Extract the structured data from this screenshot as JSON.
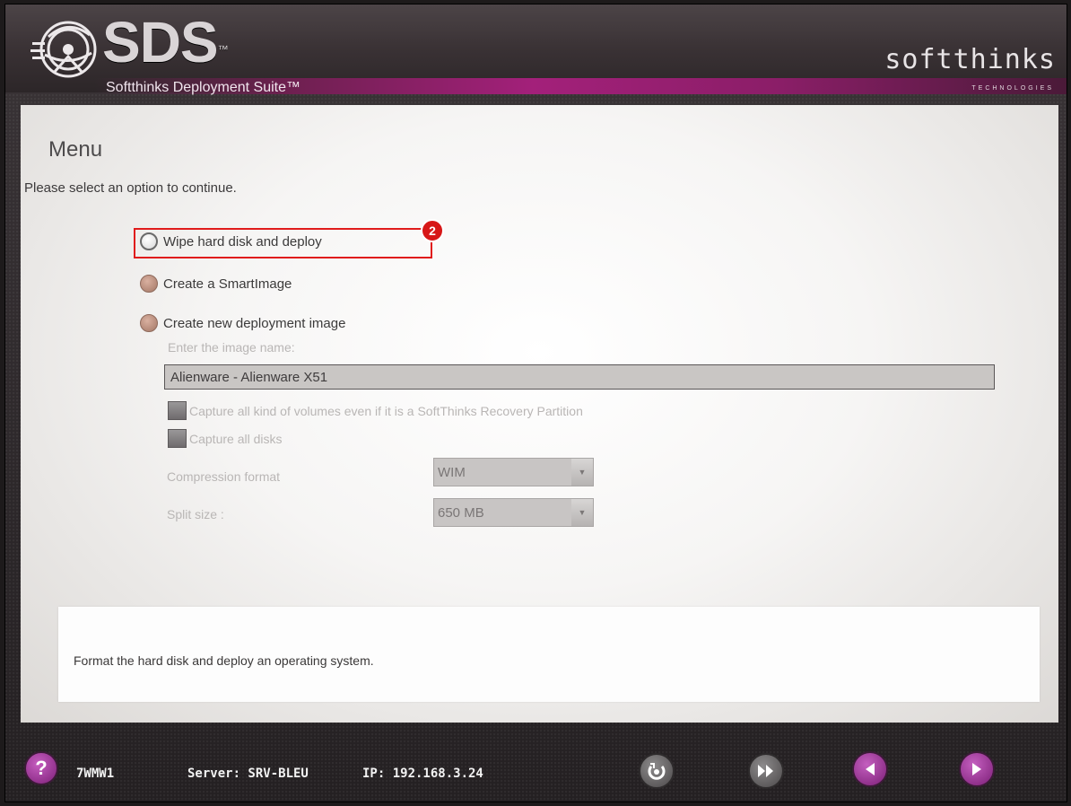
{
  "header": {
    "logo_text": "SDS",
    "logo_tm": "™",
    "suite_name": "Softthinks Deployment Suite™",
    "brand_name": "softthinks",
    "brand_sub": "TECHNOLOGIES"
  },
  "menu": {
    "title": "Menu",
    "subtitle": "Please select an option to continue.",
    "step_badge": "2",
    "options": [
      {
        "label": "Wipe hard disk and deploy",
        "selected": true
      },
      {
        "label": "Create a SmartImage",
        "selected": false
      },
      {
        "label": "Create new deployment image",
        "selected": false
      }
    ],
    "image_name_label": "Enter the image name:",
    "image_name_value": "Alienware - Alienware X51",
    "checkbox_all_volumes": "Capture all kind of volumes even if it is a SoftThinks Recovery Partition",
    "checkbox_all_disks": "Capture all disks",
    "compression_label": "Compression format",
    "compression_value": "WIM",
    "split_label": "Split size :",
    "split_value": "650 MB"
  },
  "description": "Format the hard disk and deploy an operating system.",
  "footer": {
    "help": "?",
    "machine_name": "7WMW1",
    "server": "Server: SRV-BLEU",
    "ip": "IP: 192.168.3.24"
  },
  "colors": {
    "accent": "#a3207a",
    "highlight": "#e01c1c"
  }
}
